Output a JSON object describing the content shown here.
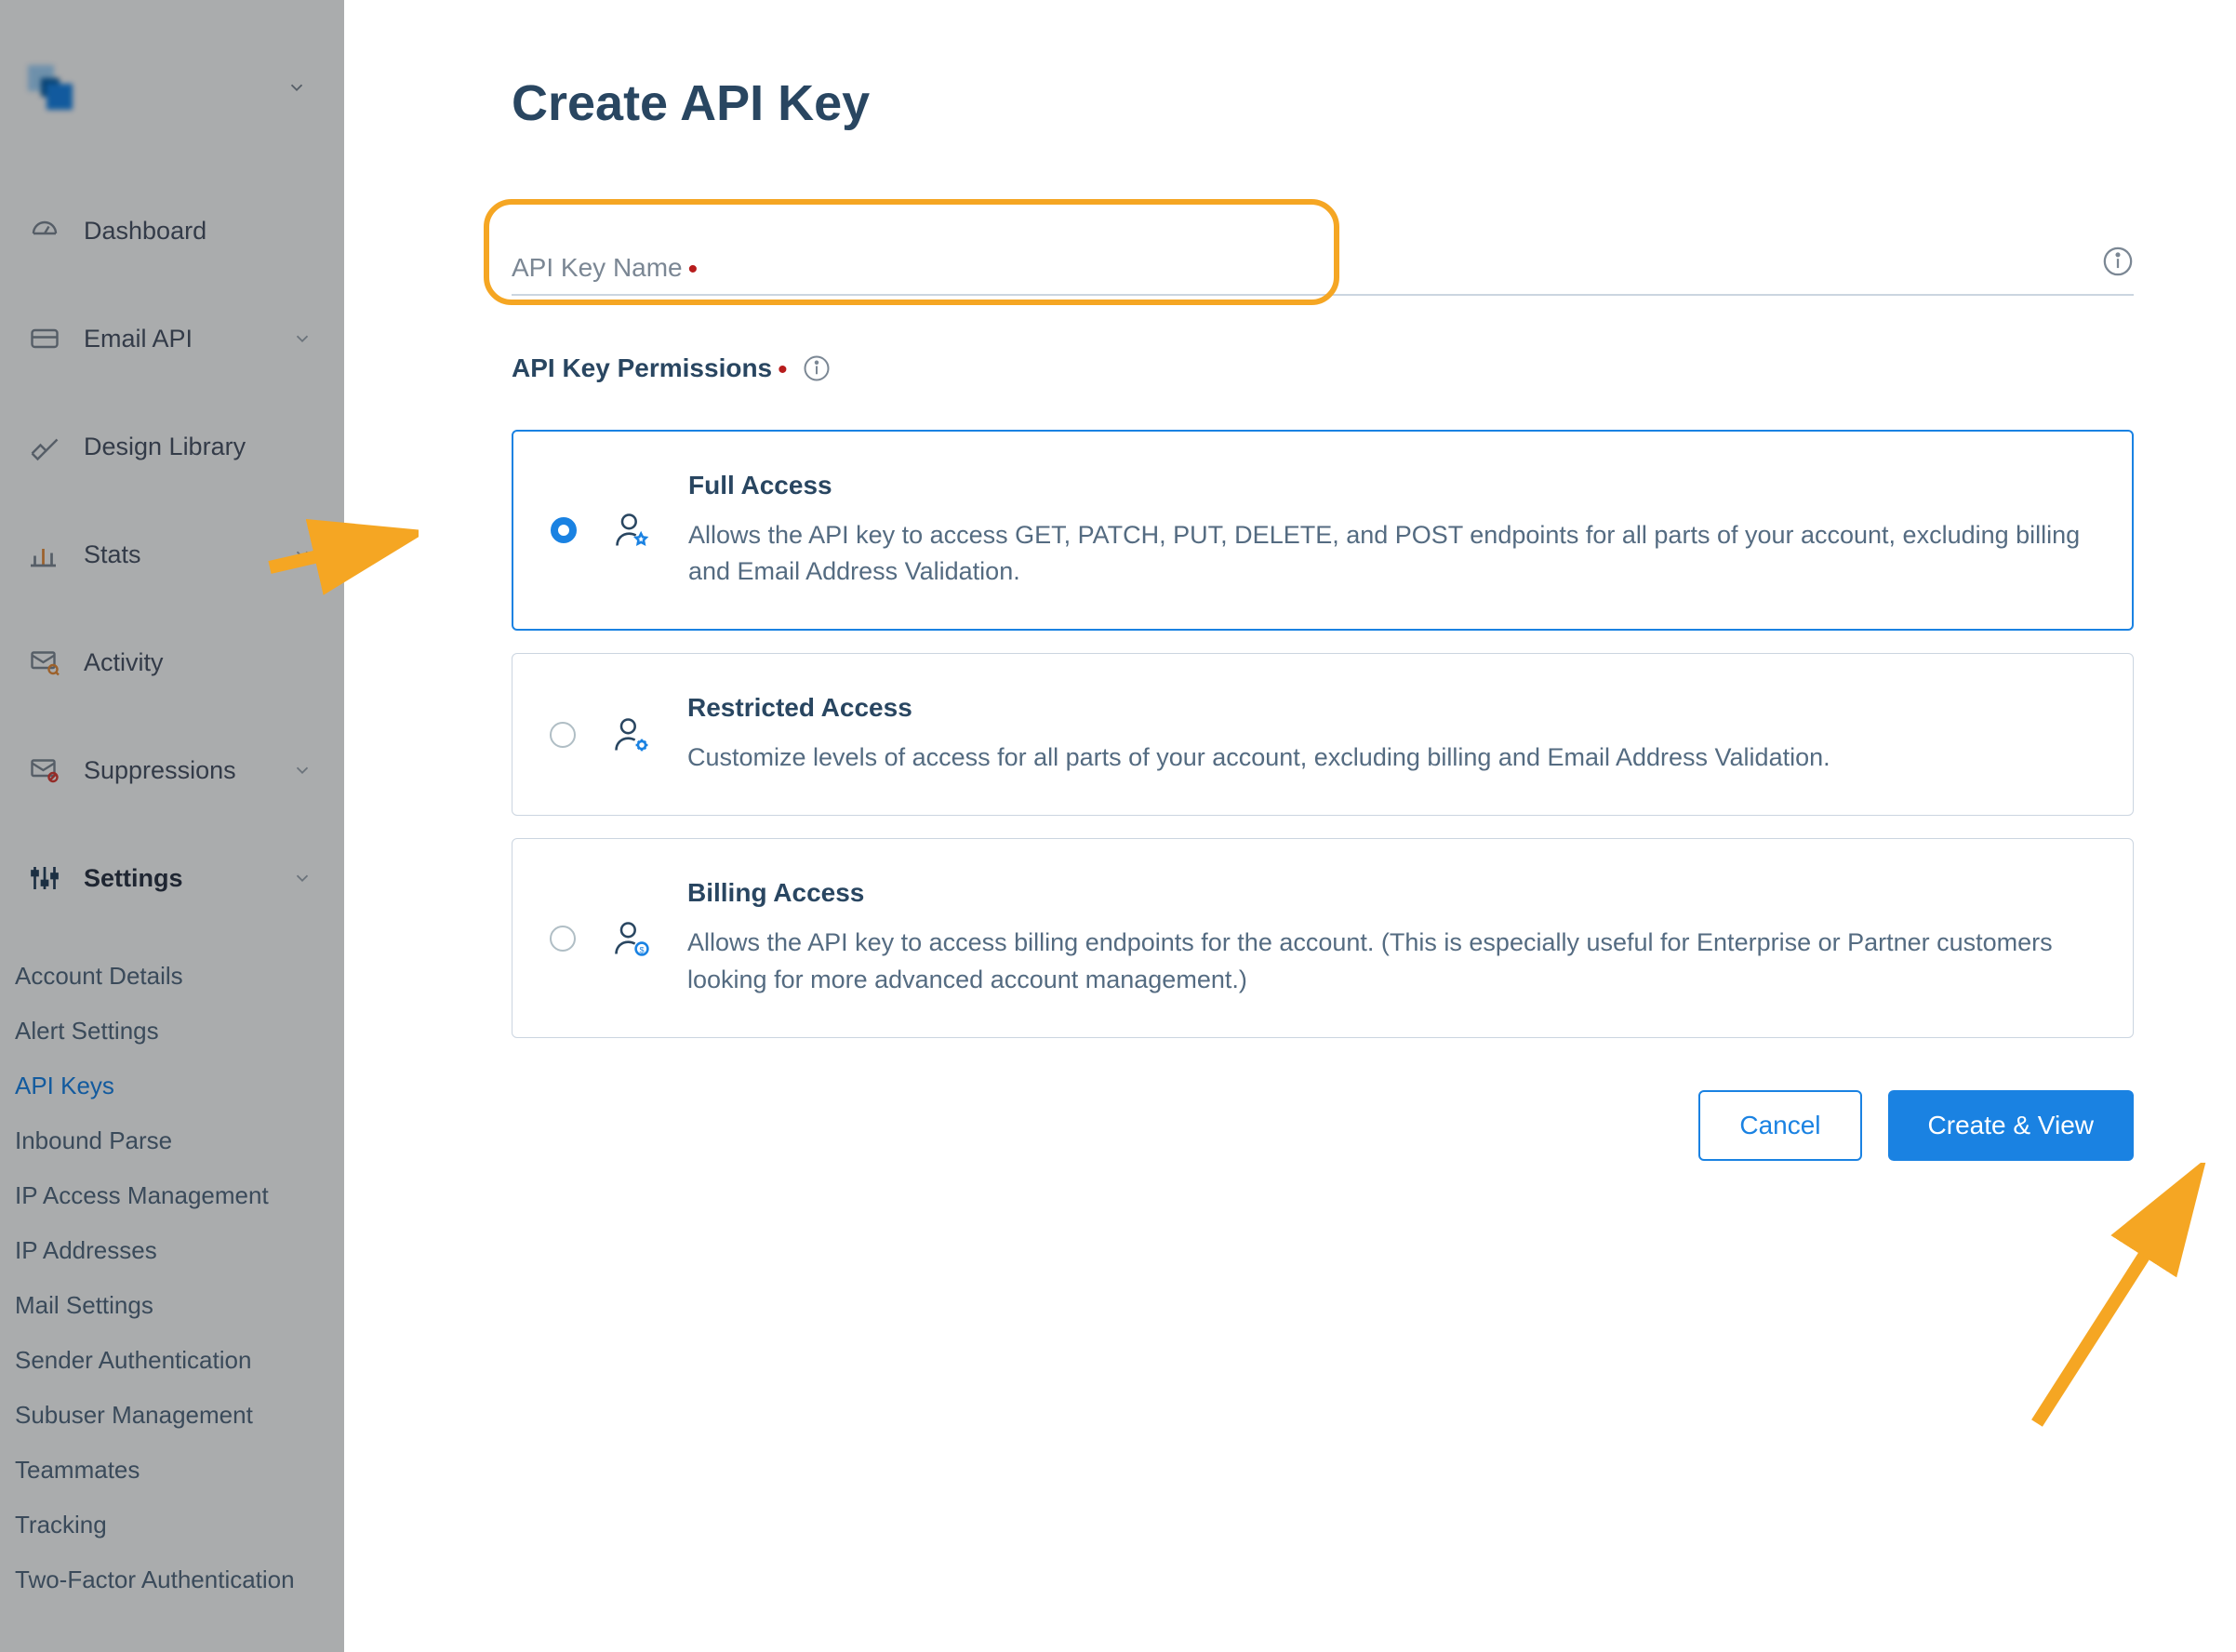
{
  "sidebar": {
    "items": [
      {
        "label": "Dashboard",
        "icon": "gauge"
      },
      {
        "label": "Email API",
        "icon": "card",
        "expandable": true
      },
      {
        "label": "Design Library",
        "icon": "pencil-ruler"
      },
      {
        "label": "Stats",
        "icon": "bar-chart",
        "expandable": true
      },
      {
        "label": "Activity",
        "icon": "envelope-check"
      },
      {
        "label": "Suppressions",
        "icon": "envelope-block",
        "expandable": true
      },
      {
        "label": "Settings",
        "icon": "sliders",
        "expandable": true,
        "active": true
      }
    ],
    "settings_sub": [
      "Account Details",
      "Alert Settings",
      "API Keys",
      "Inbound Parse",
      "IP Access Management",
      "IP Addresses",
      "Mail Settings",
      "Sender Authentication",
      "Subuser Management",
      "Teammates",
      "Tracking",
      "Two-Factor Authentication"
    ],
    "active_sub": "API Keys"
  },
  "page": {
    "title": "Create API Key",
    "name_field": {
      "label": "API Key Name",
      "value": ""
    },
    "perm_label": "API Key Permissions",
    "options": [
      {
        "key": "full",
        "title": "Full Access",
        "desc": "Allows the API key to access GET, PATCH, PUT, DELETE, and POST endpoints for all parts of your account, excluding billing and Email Address Validation.",
        "selected": true
      },
      {
        "key": "restricted",
        "title": "Restricted Access",
        "desc": "Customize levels of access for all parts of your account, excluding billing and Email Address Validation.",
        "selected": false
      },
      {
        "key": "billing",
        "title": "Billing Access",
        "desc": "Allows the API key to access billing endpoints for the account. (This is especially useful for Enterprise or Partner customers looking for more advanced account management.)",
        "selected": false
      }
    ],
    "buttons": {
      "cancel": "Cancel",
      "create": "Create & View"
    }
  }
}
